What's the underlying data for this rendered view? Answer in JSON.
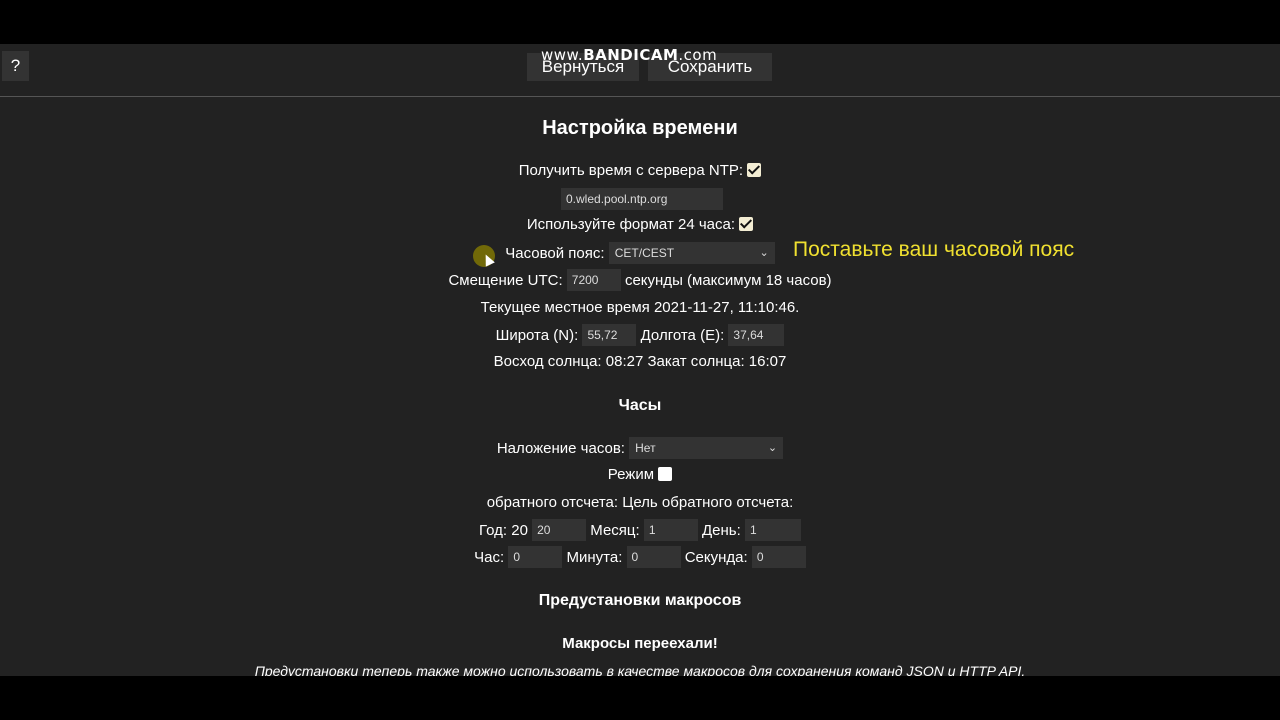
{
  "watermark": {
    "prefix": "www.",
    "brand": "BANDICAM",
    "suffix": ".com"
  },
  "topbar": {
    "help_label": "?",
    "back_label": "Вернуться",
    "save_label": "Сохранить"
  },
  "time_settings": {
    "title": "Настройка времени",
    "ntp_label": "Получить время с сервера NTP:",
    "ntp_checked": true,
    "ntp_server": "0.wled.pool.ntp.org",
    "format24_label": "Используйте формат 24 часа:",
    "format24_checked": true,
    "timezone_label": "Часовой пояс:",
    "timezone_value": "CET/CEST",
    "utc_offset_label": "Смещение UTC:",
    "utc_offset_value": "7200",
    "utc_offset_suffix": "секунды (максимум 18 часов)",
    "current_time": "Текущее местное время 2021-11-27, 11:10:46.",
    "lat_label": "Широта (N):",
    "lat_value": "55,72",
    "lon_label": "Долгота (E):",
    "lon_value": "37,64",
    "sun_times": "Восход солнца: 08:27 Закат солнца: 16:07"
  },
  "annotation": "Поставьте ваш часовой пояс",
  "clock": {
    "title": "Часы",
    "overlay_label": "Наложение часов:",
    "overlay_value": "Нет",
    "mode_label": "Режим",
    "mode_checked": false,
    "countdown_label": "обратного отсчета: Цель обратного отсчета:",
    "year_label": "Год: 20",
    "year_value": "20",
    "month_label": "Месяц:",
    "month_value": "1",
    "day_label": "День:",
    "day_value": "1",
    "hour_label": "Час:",
    "hour_value": "0",
    "minute_label": "Минута:",
    "minute_value": "0",
    "second_label": "Секунда:",
    "second_value": "0"
  },
  "macros": {
    "title": "Предустановки макросов",
    "moved_title": "Макросы переехали!",
    "note": "Предустановки теперь также можно использовать в качестве макросов для сохранения команд JSON и HTTP API."
  },
  "colors": {
    "background": "#222222",
    "field": "#333333",
    "annotation": "#f0e030"
  }
}
